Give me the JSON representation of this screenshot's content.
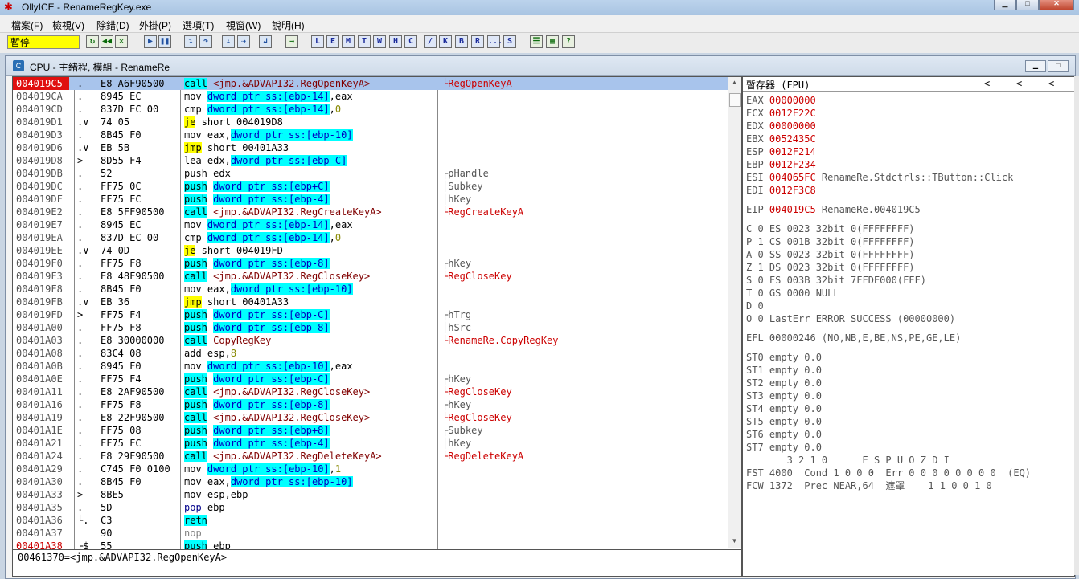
{
  "window": {
    "title": "OllyICE - RenameRegKey.exe",
    "app_icon": "bug-icon",
    "controls": [
      "minimize-icon",
      "maximize-icon",
      "close-icon"
    ]
  },
  "menu": [
    "檔案(F)",
    "檢視(V)",
    "除錯(D)",
    "外掛(P)",
    "選項(T)",
    "視窗(W)",
    "說明(H)"
  ],
  "toolbar": {
    "status": "暫停",
    "letters": [
      "L",
      "E",
      "M",
      "T",
      "W",
      "H",
      "C",
      "/",
      "K",
      "B",
      "R",
      "...",
      "S"
    ],
    "icons": [
      "open-icon",
      "restart-icon",
      "close-process-icon",
      "run-icon",
      "pause-icon",
      "step-into-icon",
      "step-over-icon",
      "trace-into-icon",
      "trace-over-icon",
      "execute-till-return-icon",
      "goto-icon",
      "list-icon",
      "grid-icon",
      "help-icon"
    ]
  },
  "cpu_window": {
    "title": "CPU - 主緒程, 模組 - RenameRe"
  },
  "disasm": [
    {
      "addr": "004019C5",
      "mark": ".",
      "hex": "E8 A6F90500",
      "mn": "call",
      "mnc": "call",
      "ops": [
        {
          "t": " <jmp.&ADVAPI32.RegOpenKeyA>",
          "c": "target"
        }
      ],
      "cmt": "└RegOpenKeyA",
      "cmtc": "red",
      "sel": true,
      "addrc": "red"
    },
    {
      "addr": "004019CA",
      "mark": ".",
      "hex": "8945 EC",
      "mn": "mov",
      "mnc": "",
      "ops": [
        {
          "t": " ",
          "c": ""
        },
        {
          "t": "dword ptr ss:[ebp-14]",
          "c": "mem"
        },
        {
          "t": ",eax",
          "c": ""
        }
      ],
      "cmt": "",
      "cmtc": ""
    },
    {
      "addr": "004019CD",
      "mark": ".",
      "hex": "837D EC 00",
      "mn": "cmp",
      "mnc": "",
      "ops": [
        {
          "t": " ",
          "c": ""
        },
        {
          "t": "dword ptr ss:[ebp-14]",
          "c": "mem"
        },
        {
          "t": ",",
          "c": ""
        },
        {
          "t": "0",
          "c": "imm"
        }
      ],
      "cmt": "",
      "cmtc": ""
    },
    {
      "addr": "004019D1",
      "mark": ".∨",
      "hex": "74 05",
      "mn": "je",
      "mnc": "jmp",
      "ops": [
        {
          "t": " short 004019D8",
          "c": ""
        }
      ],
      "cmt": "",
      "cmtc": ""
    },
    {
      "addr": "004019D3",
      "mark": ".",
      "hex": "8B45 F0",
      "mn": "mov",
      "mnc": "",
      "ops": [
        {
          "t": " eax,",
          "c": ""
        },
        {
          "t": "dword ptr ss:[ebp-10]",
          "c": "mem"
        }
      ],
      "cmt": "",
      "cmtc": ""
    },
    {
      "addr": "004019D6",
      "mark": ".∨",
      "hex": "EB 5B",
      "mn": "jmp",
      "mnc": "jmp",
      "ops": [
        {
          "t": " short 00401A33",
          "c": ""
        }
      ],
      "cmt": "",
      "cmtc": ""
    },
    {
      "addr": "004019D8",
      "mark": ">",
      "hex": "8D55 F4",
      "mn": "lea",
      "mnc": "",
      "ops": [
        {
          "t": " edx,",
          "c": ""
        },
        {
          "t": "dword ptr ss:[ebp-C]",
          "c": "mem"
        }
      ],
      "cmt": "",
      "cmtc": ""
    },
    {
      "addr": "004019DB",
      "mark": ".",
      "hex": "52",
      "mn": "push",
      "mnc": "push",
      "ops": [
        {
          "t": " edx",
          "c": ""
        }
      ],
      "cmt": "┌pHandle",
      "cmtc": ""
    },
    {
      "addr": "004019DC",
      "mark": ".",
      "hex": "FF75 0C",
      "mn": "push",
      "mnc": "call",
      "ops": [
        {
          "t": " ",
          "c": ""
        },
        {
          "t": "dword ptr ss:[ebp+C]",
          "c": "mem"
        }
      ],
      "cmt": "│Subkey",
      "cmtc": ""
    },
    {
      "addr": "004019DF",
      "mark": ".",
      "hex": "FF75 FC",
      "mn": "push",
      "mnc": "call",
      "ops": [
        {
          "t": " ",
          "c": ""
        },
        {
          "t": "dword ptr ss:[ebp-4]",
          "c": "mem"
        }
      ],
      "cmt": "│hKey",
      "cmtc": ""
    },
    {
      "addr": "004019E2",
      "mark": ".",
      "hex": "E8 5FF90500",
      "mn": "call",
      "mnc": "call",
      "ops": [
        {
          "t": " <jmp.&ADVAPI32.RegCreateKeyA>",
          "c": "target"
        }
      ],
      "cmt": "└RegCreateKeyA",
      "cmtc": "red"
    },
    {
      "addr": "004019E7",
      "mark": ".",
      "hex": "8945 EC",
      "mn": "mov",
      "mnc": "",
      "ops": [
        {
          "t": " ",
          "c": ""
        },
        {
          "t": "dword ptr ss:[ebp-14]",
          "c": "mem"
        },
        {
          "t": ",eax",
          "c": ""
        }
      ],
      "cmt": "",
      "cmtc": ""
    },
    {
      "addr": "004019EA",
      "mark": ".",
      "hex": "837D EC 00",
      "mn": "cmp",
      "mnc": "",
      "ops": [
        {
          "t": " ",
          "c": ""
        },
        {
          "t": "dword ptr ss:[ebp-14]",
          "c": "mem"
        },
        {
          "t": ",",
          "c": ""
        },
        {
          "t": "0",
          "c": "imm"
        }
      ],
      "cmt": "",
      "cmtc": ""
    },
    {
      "addr": "004019EE",
      "mark": ".∨",
      "hex": "74 0D",
      "mn": "je",
      "mnc": "jmp",
      "ops": [
        {
          "t": " short 004019FD",
          "c": ""
        }
      ],
      "cmt": "",
      "cmtc": ""
    },
    {
      "addr": "004019F0",
      "mark": ".",
      "hex": "FF75 F8",
      "mn": "push",
      "mnc": "call",
      "ops": [
        {
          "t": " ",
          "c": ""
        },
        {
          "t": "dword ptr ss:[ebp-8]",
          "c": "mem"
        }
      ],
      "cmt": "┌hKey",
      "cmtc": ""
    },
    {
      "addr": "004019F3",
      "mark": ".",
      "hex": "E8 48F90500",
      "mn": "call",
      "mnc": "call",
      "ops": [
        {
          "t": " <jmp.&ADVAPI32.RegCloseKey>",
          "c": "target"
        }
      ],
      "cmt": "└RegCloseKey",
      "cmtc": "red"
    },
    {
      "addr": "004019F8",
      "mark": ".",
      "hex": "8B45 F0",
      "mn": "mov",
      "mnc": "",
      "ops": [
        {
          "t": " eax,",
          "c": ""
        },
        {
          "t": "dword ptr ss:[ebp-10]",
          "c": "mem"
        }
      ],
      "cmt": "",
      "cmtc": ""
    },
    {
      "addr": "004019FB",
      "mark": ".∨",
      "hex": "EB 36",
      "mn": "jmp",
      "mnc": "jmp",
      "ops": [
        {
          "t": " short 00401A33",
          "c": ""
        }
      ],
      "cmt": "",
      "cmtc": ""
    },
    {
      "addr": "004019FD",
      "mark": ">",
      "hex": "FF75 F4",
      "mn": "push",
      "mnc": "call",
      "ops": [
        {
          "t": " ",
          "c": ""
        },
        {
          "t": "dword ptr ss:[ebp-C]",
          "c": "mem"
        }
      ],
      "cmt": "┌hTrg",
      "cmtc": ""
    },
    {
      "addr": "00401A00",
      "mark": ".",
      "hex": "FF75 F8",
      "mn": "push",
      "mnc": "call",
      "ops": [
        {
          "t": " ",
          "c": ""
        },
        {
          "t": "dword ptr ss:[ebp-8]",
          "c": "mem"
        }
      ],
      "cmt": "│hSrc",
      "cmtc": ""
    },
    {
      "addr": "00401A03",
      "mark": ".",
      "hex": "E8 30000000",
      "mn": "call",
      "mnc": "call",
      "ops": [
        {
          "t": " CopyRegKey",
          "c": "target"
        }
      ],
      "cmt": "└RenameRe.CopyRegKey",
      "cmtc": "red"
    },
    {
      "addr": "00401A08",
      "mark": ".",
      "hex": "83C4 08",
      "mn": "add",
      "mnc": "",
      "ops": [
        {
          "t": " esp,",
          "c": ""
        },
        {
          "t": "8",
          "c": "imm"
        }
      ],
      "cmt": "",
      "cmtc": ""
    },
    {
      "addr": "00401A0B",
      "mark": ".",
      "hex": "8945 F0",
      "mn": "mov",
      "mnc": "",
      "ops": [
        {
          "t": " ",
          "c": ""
        },
        {
          "t": "dword ptr ss:[ebp-10]",
          "c": "mem"
        },
        {
          "t": ",eax",
          "c": ""
        }
      ],
      "cmt": "",
      "cmtc": ""
    },
    {
      "addr": "00401A0E",
      "mark": ".",
      "hex": "FF75 F4",
      "mn": "push",
      "mnc": "call",
      "ops": [
        {
          "t": " ",
          "c": ""
        },
        {
          "t": "dword ptr ss:[ebp-C]",
          "c": "mem"
        }
      ],
      "cmt": "┌hKey",
      "cmtc": ""
    },
    {
      "addr": "00401A11",
      "mark": ".",
      "hex": "E8 2AF90500",
      "mn": "call",
      "mnc": "call",
      "ops": [
        {
          "t": " <jmp.&ADVAPI32.RegCloseKey>",
          "c": "target"
        }
      ],
      "cmt": "└RegCloseKey",
      "cmtc": "red"
    },
    {
      "addr": "00401A16",
      "mark": ".",
      "hex": "FF75 F8",
      "mn": "push",
      "mnc": "call",
      "ops": [
        {
          "t": " ",
          "c": ""
        },
        {
          "t": "dword ptr ss:[ebp-8]",
          "c": "mem"
        }
      ],
      "cmt": "┌hKey",
      "cmtc": ""
    },
    {
      "addr": "00401A19",
      "mark": ".",
      "hex": "E8 22F90500",
      "mn": "call",
      "mnc": "call",
      "ops": [
        {
          "t": " <jmp.&ADVAPI32.RegCloseKey>",
          "c": "target"
        }
      ],
      "cmt": "└RegCloseKey",
      "cmtc": "red"
    },
    {
      "addr": "00401A1E",
      "mark": ".",
      "hex": "FF75 08",
      "mn": "push",
      "mnc": "call",
      "ops": [
        {
          "t": " ",
          "c": ""
        },
        {
          "t": "dword ptr ss:[ebp+8]",
          "c": "mem"
        }
      ],
      "cmt": "┌Subkey",
      "cmtc": ""
    },
    {
      "addr": "00401A21",
      "mark": ".",
      "hex": "FF75 FC",
      "mn": "push",
      "mnc": "call",
      "ops": [
        {
          "t": " ",
          "c": ""
        },
        {
          "t": "dword ptr ss:[ebp-4]",
          "c": "mem"
        }
      ],
      "cmt": "│hKey",
      "cmtc": ""
    },
    {
      "addr": "00401A24",
      "mark": ".",
      "hex": "E8 29F90500",
      "mn": "call",
      "mnc": "call",
      "ops": [
        {
          "t": " <jmp.&ADVAPI32.RegDeleteKeyA>",
          "c": "target"
        }
      ],
      "cmt": "└RegDeleteKeyA",
      "cmtc": "red"
    },
    {
      "addr": "00401A29",
      "mark": ".",
      "hex": "C745 F0 0100",
      "mn": "mov",
      "mnc": "",
      "ops": [
        {
          "t": " ",
          "c": ""
        },
        {
          "t": "dword ptr ss:[ebp-10]",
          "c": "mem"
        },
        {
          "t": ",",
          "c": ""
        },
        {
          "t": "1",
          "c": "imm"
        }
      ],
      "cmt": "",
      "cmtc": ""
    },
    {
      "addr": "00401A30",
      "mark": ".",
      "hex": "8B45 F0",
      "mn": "mov",
      "mnc": "",
      "ops": [
        {
          "t": " eax,",
          "c": ""
        },
        {
          "t": "dword ptr ss:[ebp-10]",
          "c": "mem"
        }
      ],
      "cmt": "",
      "cmtc": ""
    },
    {
      "addr": "00401A33",
      "mark": ">",
      "hex": "8BE5",
      "mn": "mov",
      "mnc": "",
      "ops": [
        {
          "t": " esp,ebp",
          "c": ""
        }
      ],
      "cmt": "",
      "cmtc": ""
    },
    {
      "addr": "00401A35",
      "mark": ".",
      "hex": "5D",
      "mn": "pop",
      "mnc": "pop",
      "ops": [
        {
          "t": " ebp",
          "c": ""
        }
      ],
      "cmt": "",
      "cmtc": ""
    },
    {
      "addr": "00401A36",
      "mark": "└.",
      "hex": "C3",
      "mn": "retn",
      "mnc": "retn",
      "ops": [],
      "cmt": "",
      "cmtc": ""
    },
    {
      "addr": "00401A37",
      "mark": "",
      "hex": "90",
      "mn": "nop",
      "mnc": "nop",
      "ops": [],
      "cmt": "",
      "cmtc": ""
    },
    {
      "addr": "00401A38",
      "mark": "┌$",
      "hex": "55",
      "mn": "push",
      "mnc": "call",
      "ops": [
        {
          "t": " ebp",
          "c": ""
        }
      ],
      "cmt": "",
      "cmtc": "",
      "addrc": "redtext"
    }
  ],
  "info_line": "00461370=<jmp.&ADVAPI32.RegOpenKeyA>",
  "registers": {
    "header": "暫存器 (FPU)",
    "header_arrows": [
      "<",
      "<",
      "<"
    ],
    "lines": [
      {
        "name": "EAX",
        "value": "00000000",
        "vc": "red",
        "rest": ""
      },
      {
        "name": "ECX",
        "value": "0012F22C",
        "vc": "red",
        "rest": ""
      },
      {
        "name": "EDX",
        "value": "00000000",
        "vc": "red",
        "rest": ""
      },
      {
        "name": "EBX",
        "value": "0052435C",
        "vc": "red",
        "rest": ""
      },
      {
        "name": "ESP",
        "value": "0012F214",
        "vc": "red",
        "rest": ""
      },
      {
        "name": "EBP",
        "value": "0012F234",
        "vc": "red",
        "rest": ""
      },
      {
        "name": "ESI",
        "value": "004065FC",
        "vc": "red",
        "rest": " RenameRe.Stdctrls::TButton::Click"
      },
      {
        "name": "EDI",
        "value": "0012F3C8",
        "vc": "red",
        "rest": ""
      },
      {
        "name": "EIP",
        "value": "004019C5",
        "vc": "red",
        "rest": " RenameRe.004019C5"
      },
      {
        "name": "C 0",
        "value": "ES 0023",
        "vc": "gray",
        "rest": " 32bit 0(FFFFFFFF)"
      },
      {
        "name": "P 1",
        "value": "CS 001B",
        "vc": "gray",
        "rest": " 32bit 0(FFFFFFFF)"
      },
      {
        "name": "A 0",
        "value": "SS 0023",
        "vc": "gray",
        "rest": " 32bit 0(FFFFFFFF)"
      },
      {
        "name": "Z 1",
        "value": "DS 0023",
        "vc": "gray",
        "rest": " 32bit 0(FFFFFFFF)"
      },
      {
        "name": "S 0",
        "value": "FS 003B",
        "vc": "gray",
        "rest": " 32bit 7FFDE000(FFF)"
      },
      {
        "name": "T 0",
        "value": "GS 0000",
        "vc": "gray",
        "rest": " NULL"
      },
      {
        "name": "D 0",
        "value": "",
        "vc": "gray",
        "rest": ""
      },
      {
        "name": "O 0",
        "value": "LastErr",
        "vc": "gray",
        "rest": " ERROR_SUCCESS (00000000)"
      },
      {
        "name": "EFL",
        "value": "00000246",
        "vc": "gray",
        "rest": " (NO,NB,E,BE,NS,PE,GE,LE)"
      },
      {
        "name": "ST0",
        "value": "empty",
        "vc": "gray",
        "rest": " 0.0"
      },
      {
        "name": "ST1",
        "value": "empty",
        "vc": "gray",
        "rest": " 0.0"
      },
      {
        "name": "ST2",
        "value": "empty",
        "vc": "gray",
        "rest": " 0.0"
      },
      {
        "name": "ST3",
        "value": "empty",
        "vc": "gray",
        "rest": " 0.0"
      },
      {
        "name": "ST4",
        "value": "empty",
        "vc": "gray",
        "rest": " 0.0"
      },
      {
        "name": "ST5",
        "value": "empty",
        "vc": "gray",
        "rest": " 0.0"
      },
      {
        "name": "ST6",
        "value": "empty",
        "vc": "gray",
        "rest": " 0.0"
      },
      {
        "name": "ST7",
        "value": "empty",
        "vc": "gray",
        "rest": " 0.0"
      },
      {
        "name": "",
        "value": "",
        "vc": "gray",
        "rest": "       3 2 1 0      E S P U O Z D I"
      },
      {
        "name": "FST",
        "value": "4000",
        "vc": "gray",
        "rest": "  Cond 1 0 0 0  Err 0 0 0 0 0 0 0 0  (EQ)"
      },
      {
        "name": "FCW",
        "value": "1372",
        "vc": "gray",
        "rest": "  Prec NEAR,64  遮罩    1 1 0 0 1 0"
      }
    ]
  }
}
